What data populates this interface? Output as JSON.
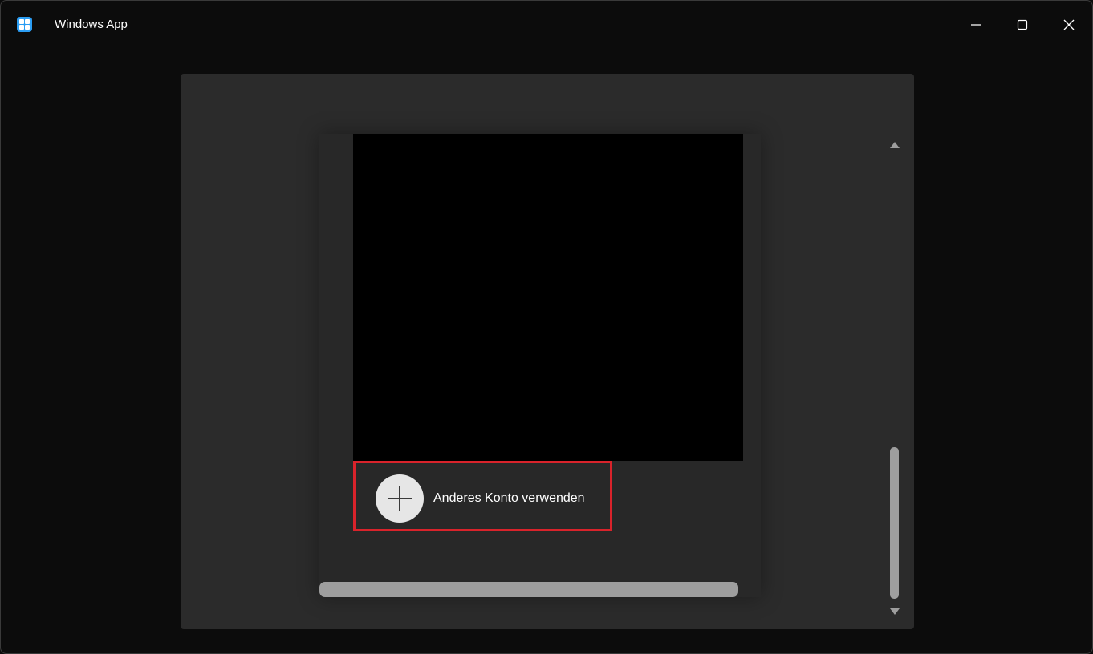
{
  "window": {
    "title": "Windows App",
    "icon": "windows-app-icon"
  },
  "caption_buttons": {
    "minimize_icon": "minimize-icon",
    "maximize_icon": "maximize-icon",
    "close_icon": "close-icon"
  },
  "dialog": {
    "account_option": {
      "label": "Anderes Konto verwenden",
      "icon": "plus-icon"
    },
    "highlight_color": "#d9232b"
  },
  "colors": {
    "window_bg": "#0c0c0c",
    "dialog_bg": "#2b2b2b",
    "webview_bg": "#000000",
    "scrollbar": "#9e9e9e",
    "icon_bg": "#2b9df3"
  }
}
